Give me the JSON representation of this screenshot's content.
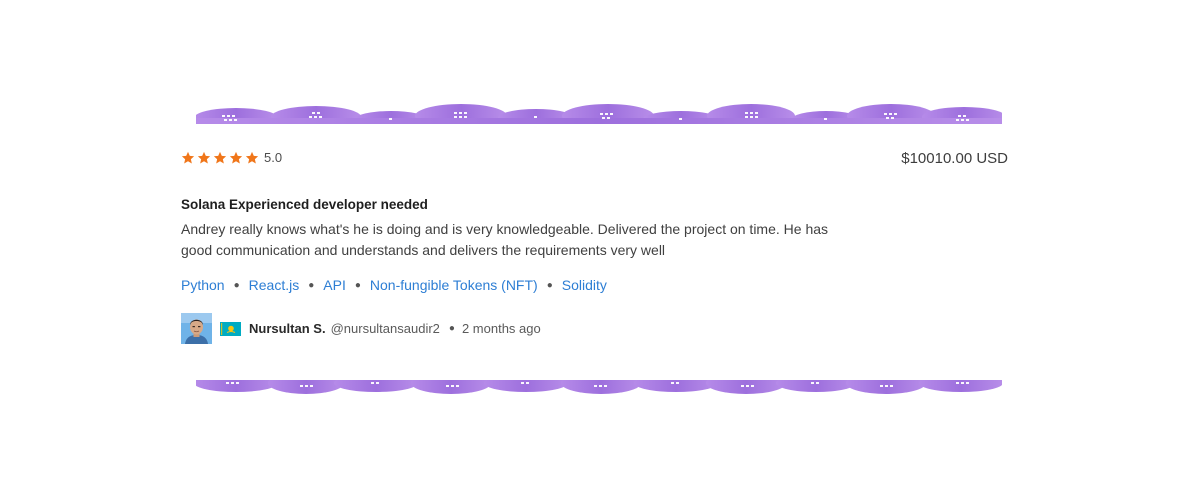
{
  "review": {
    "rating": 5,
    "rating_label": "5.0",
    "price": "$10010.00 USD",
    "title": "Solana Experienced developer needed",
    "text": "Andrey really knows what's he is doing and is very knowledgeable. Delivered the project on time. He has good communication and understands and delivers the requirements very well",
    "skills": [
      "Python",
      "React.js",
      "API",
      "Non-fungible Tokens (NFT)",
      "Solidity"
    ],
    "author": {
      "name": "Nursultan S.",
      "handle": "@nursultansaudir2",
      "time_ago": "2 months ago",
      "flag_icon": "kazakhstan-flag-icon"
    }
  },
  "colors": {
    "star": "#f0761a",
    "link": "#2d7ed4",
    "decoration": "#a77de2"
  }
}
